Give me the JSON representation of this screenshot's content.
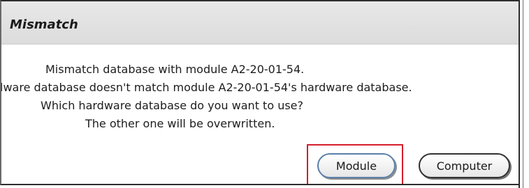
{
  "dialog": {
    "title": "Mismatch",
    "message_lines": [
      "Mismatch database with module A2-20-01-54.",
      "rdware database doesn't match module A2-20-01-54's hardware database.",
      "Which hardware database do you want to use?",
      "The other one will be overwritten."
    ],
    "buttons": {
      "module_label": "Module",
      "computer_label": "Computer"
    },
    "highlight_color": "#d51e2a"
  }
}
